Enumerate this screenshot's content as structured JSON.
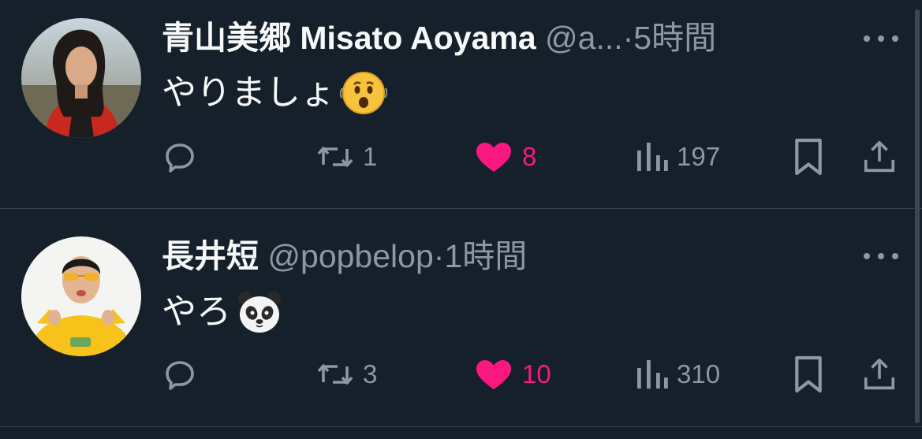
{
  "tweets": [
    {
      "display_name": "青山美郷 Misato Aoyama",
      "handle": "@a...",
      "separator": "·",
      "time": "5時間",
      "text": "やりましょ",
      "emoji": "hushed-face-emoji",
      "replies": "",
      "retweets": "1",
      "likes": "8",
      "liked": true,
      "views": "197"
    },
    {
      "display_name": "長井短",
      "handle": "@popbelop",
      "separator": "·",
      "time": "1時間",
      "text": "やろ",
      "emoji": "panda-face-emoji",
      "replies": "",
      "retweets": "3",
      "likes": "10",
      "liked": true,
      "views": "310"
    }
  ],
  "icons": {
    "reply": "reply-icon",
    "retweet": "retweet-icon",
    "like": "heart-icon",
    "views": "views-chart-icon",
    "bookmark": "bookmark-icon",
    "share": "share-icon",
    "more": "more-dots-icon"
  },
  "colors": {
    "background": "#15202b",
    "text": "#f7f9f9",
    "muted": "#8b98a5",
    "like": "#f91880",
    "divider": "#38444d"
  }
}
